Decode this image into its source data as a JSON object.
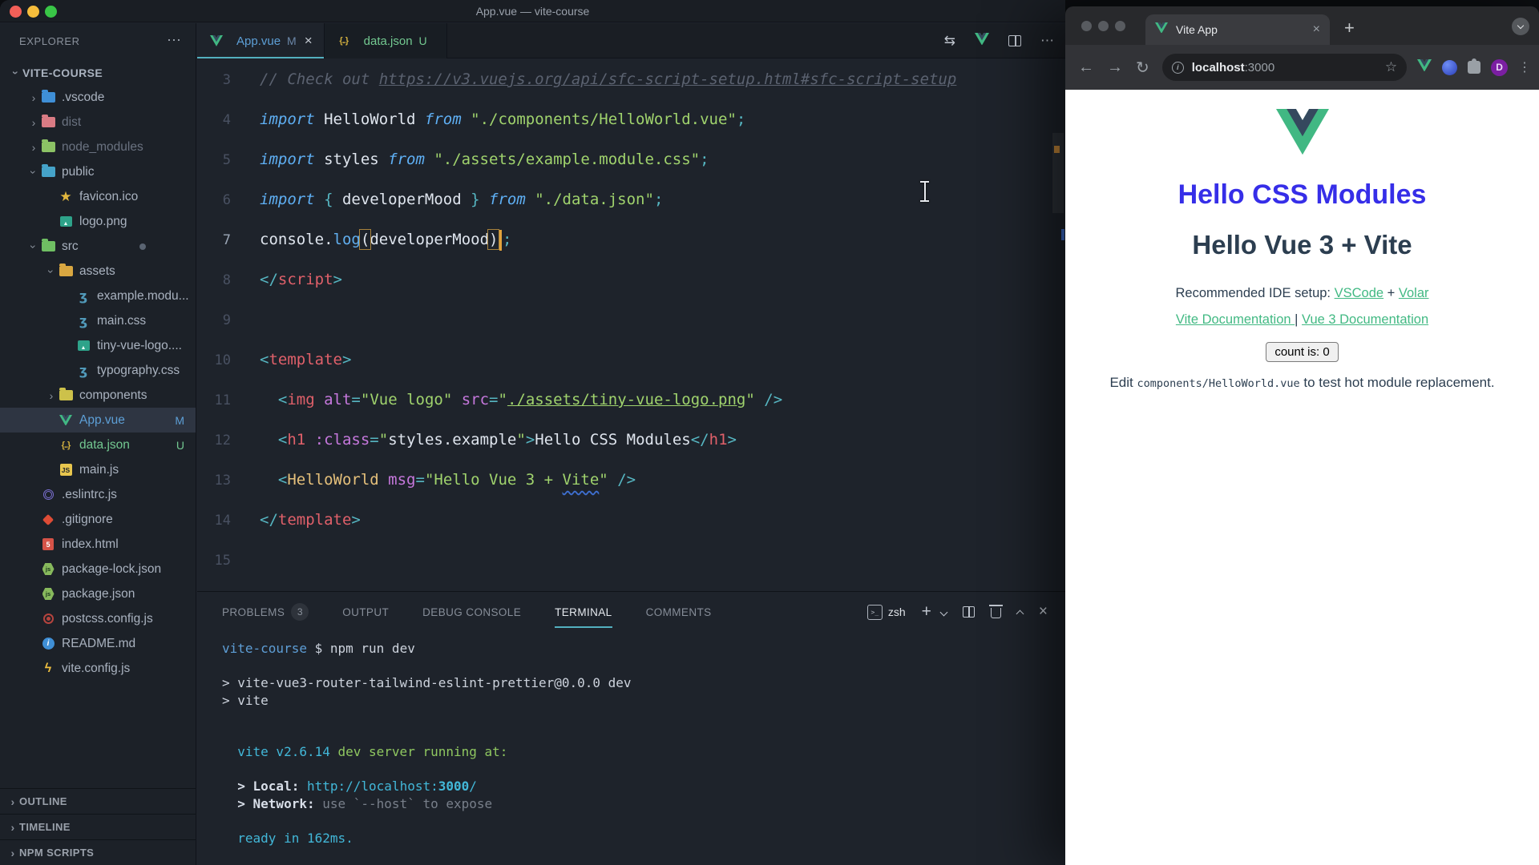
{
  "vscode": {
    "titlebar": {
      "title": "App.vue — vite-course"
    },
    "explorer": {
      "header": "EXPLORER",
      "actions_icon": "⋯",
      "root": "VITE-COURSE",
      "tree": [
        {
          "label": ".vscode",
          "icon": "folder-vscode",
          "indent": 1,
          "chevron": "right"
        },
        {
          "label": "dist",
          "icon": "folder-dist",
          "indent": 1,
          "chevron": "right",
          "muted": true
        },
        {
          "label": "node_modules",
          "icon": "folder-node",
          "indent": 1,
          "chevron": "right",
          "muted": true
        },
        {
          "label": "public",
          "icon": "folder-public",
          "indent": 1,
          "chevron": "down"
        },
        {
          "label": "favicon.ico",
          "icon": "star",
          "indent": 2
        },
        {
          "label": "logo.png",
          "icon": "image",
          "indent": 2
        },
        {
          "label": "src",
          "icon": "folder-src",
          "indent": 1,
          "chevron": "down",
          "dot": true
        },
        {
          "label": "assets",
          "icon": "folder-assets",
          "indent": 2,
          "chevron": "down"
        },
        {
          "label": "example.modu...",
          "icon": "css",
          "indent": 3
        },
        {
          "label": "main.css",
          "icon": "css",
          "indent": 3
        },
        {
          "label": "tiny-vue-logo....",
          "icon": "image",
          "indent": 3
        },
        {
          "label": "typography.css",
          "icon": "css",
          "indent": 3
        },
        {
          "label": "components",
          "icon": "folder-components",
          "indent": 2,
          "chevron": "right"
        },
        {
          "label": "App.vue",
          "icon": "vue",
          "indent": 2,
          "selected": true,
          "badge": "M",
          "color": "blue"
        },
        {
          "label": "data.json",
          "icon": "json",
          "indent": 2,
          "badge": "U",
          "color": "green"
        },
        {
          "label": "main.js",
          "icon": "js",
          "indent": 2
        },
        {
          "label": ".eslintrc.js",
          "icon": "eslint",
          "indent": 1
        },
        {
          "label": ".gitignore",
          "icon": "git",
          "indent": 1
        },
        {
          "label": "index.html",
          "icon": "html",
          "indent": 1
        },
        {
          "label": "package-lock.json",
          "icon": "npm",
          "indent": 1
        },
        {
          "label": "package.json",
          "icon": "npm",
          "indent": 1
        },
        {
          "label": "postcss.config.js",
          "icon": "postcss",
          "indent": 1
        },
        {
          "label": "README.md",
          "icon": "readme",
          "indent": 1
        },
        {
          "label": "vite.config.js",
          "icon": "vite",
          "indent": 1
        }
      ],
      "sections": [
        "OUTLINE",
        "TIMELINE",
        "NPM SCRIPTS"
      ]
    },
    "tabs": [
      {
        "label": "App.vue",
        "icon": "vue",
        "badge": "M",
        "close": "×",
        "active": true,
        "color": "blue"
      },
      {
        "label": "data.json",
        "icon": "json",
        "badge": "U",
        "active": false,
        "color": "green"
      }
    ],
    "editor_lines": [
      {
        "n": "3",
        "tokens": [
          [
            "com",
            "// Check out "
          ],
          [
            "comU",
            "https://v3.vuejs.org/api/sfc-script-setup.html#sfc-script-setup"
          ]
        ]
      },
      {
        "n": "4",
        "tokens": [
          [
            "kw",
            "import"
          ],
          [
            "id",
            " HelloWorld "
          ],
          [
            "kw",
            "from"
          ],
          [
            "str",
            " \"./components/HelloWorld.vue\""
          ],
          [
            "pun",
            ";"
          ]
        ]
      },
      {
        "n": "5",
        "tokens": [
          [
            "kw",
            "import"
          ],
          [
            "id",
            " styles "
          ],
          [
            "kw",
            "from"
          ],
          [
            "str",
            " \"./assets/example.module.css\""
          ],
          [
            "pun",
            ";"
          ]
        ]
      },
      {
        "n": "6",
        "tokens": [
          [
            "kw",
            "import"
          ],
          [
            "pun",
            " { "
          ],
          [
            "id",
            "developerMood"
          ],
          [
            "pun",
            " } "
          ],
          [
            "kw",
            "from"
          ],
          [
            "str",
            " \"./data.json\""
          ],
          [
            "pun",
            ";"
          ]
        ]
      },
      {
        "n": "7",
        "active": true,
        "tokens": [
          [
            "id",
            "console"
          ],
          [
            "id",
            "."
          ],
          [
            "fn",
            "log"
          ],
          [
            "box",
            "("
          ],
          [
            "id",
            "developerMood"
          ],
          [
            "box",
            ")"
          ],
          [
            "cursor",
            ""
          ],
          [
            "pun",
            ";"
          ]
        ]
      },
      {
        "n": "8",
        "tokens": [
          [
            "pun",
            "</"
          ],
          [
            "tag",
            "script"
          ],
          [
            "pun",
            ">"
          ]
        ]
      },
      {
        "n": "9",
        "tokens": []
      },
      {
        "n": "10",
        "tokens": [
          [
            "pun",
            "<"
          ],
          [
            "tag",
            "template"
          ],
          [
            "pun",
            ">"
          ]
        ]
      },
      {
        "n": "11",
        "tokens": [
          [
            "pun",
            "  <"
          ],
          [
            "tag",
            "img"
          ],
          [
            "attr",
            " alt"
          ],
          [
            "pun",
            "="
          ],
          [
            "str",
            "\"Vue logo\""
          ],
          [
            "attr",
            " src"
          ],
          [
            "pun",
            "="
          ],
          [
            "str",
            "\""
          ],
          [
            "strU",
            "./assets/tiny-vue-logo.png"
          ],
          [
            "str",
            "\""
          ],
          [
            "pun",
            " />"
          ]
        ]
      },
      {
        "n": "12",
        "tokens": [
          [
            "pun",
            "  <"
          ],
          [
            "tag",
            "h1"
          ],
          [
            "attr",
            " :class"
          ],
          [
            "pun",
            "="
          ],
          [
            "str",
            "\""
          ],
          [
            "id",
            "styles.example"
          ],
          [
            "str",
            "\""
          ],
          [
            "pun",
            ">"
          ],
          [
            "id",
            "Hello CSS Modules"
          ],
          [
            "pun",
            "</"
          ],
          [
            "tag",
            "h1"
          ],
          [
            "pun",
            ">"
          ]
        ]
      },
      {
        "n": "13",
        "tokens": [
          [
            "pun",
            "  <"
          ],
          [
            "comp",
            "HelloWorld"
          ],
          [
            "attr",
            " msg"
          ],
          [
            "pun",
            "="
          ],
          [
            "str",
            "\"Hello Vue 3 + "
          ],
          [
            "wavy",
            "Vite"
          ],
          [
            "str",
            "\""
          ],
          [
            "pun",
            " />"
          ]
        ]
      },
      {
        "n": "14",
        "tokens": [
          [
            "pun",
            "</"
          ],
          [
            "tag",
            "template"
          ],
          [
            "pun",
            ">"
          ]
        ]
      },
      {
        "n": "15",
        "tokens": []
      }
    ],
    "panel": {
      "tabs": [
        {
          "label": "PROBLEMS",
          "badge": "3"
        },
        {
          "label": "OUTPUT"
        },
        {
          "label": "DEBUG CONSOLE"
        },
        {
          "label": "TERMINAL",
          "active": true
        },
        {
          "label": "COMMENTS"
        }
      ],
      "shell": "zsh",
      "terminal": [
        {
          "segs": [
            [
              "tb",
              "vite-course"
            ],
            [
              "tw",
              " $ npm run dev"
            ]
          ]
        },
        {
          "segs": []
        },
        {
          "segs": [
            [
              "tw",
              "> vite-vue3-router-tailwind-eslint-prettier@0.0.0 dev"
            ]
          ]
        },
        {
          "segs": [
            [
              "tw",
              "> vite"
            ]
          ]
        },
        {
          "segs": []
        },
        {
          "segs": []
        },
        {
          "segs": [
            [
              "tc",
              "  vite v2.6.14"
            ],
            [
              "tg",
              " dev server running at:"
            ]
          ]
        },
        {
          "segs": []
        },
        {
          "segs": [
            [
              "twb",
              "  > Local: "
            ],
            [
              "tc",
              "http://localhost:"
            ],
            [
              "tcb",
              "3000"
            ],
            [
              "tc",
              "/"
            ]
          ]
        },
        {
          "segs": [
            [
              "twb",
              "  > Network: "
            ],
            [
              "tdim",
              "use `--host` to expose"
            ]
          ]
        },
        {
          "segs": []
        },
        {
          "segs": [
            [
              "tc",
              "  ready in 162ms."
            ]
          ]
        }
      ]
    }
  },
  "browser": {
    "tab": {
      "title": "Vite App",
      "close": "×"
    },
    "newtab_icon": "+",
    "address": {
      "host": "localhost",
      "port": ":3000",
      "star": "☆",
      "back": "←",
      "forward": "→",
      "reload": "↻",
      "info": "i"
    },
    "avatar_letter": "D",
    "menu_icon": "⋮",
    "page": {
      "heading_css_modules": "Hello CSS Modules",
      "heading_msg": "Hello Vue 3 + Vite",
      "ide_prefix": "Recommended IDE setup: ",
      "ide_link1": "VSCode",
      "ide_sep": " + ",
      "ide_link2": "Volar",
      "docs_link1": "Vite Documentation ",
      "docs_sep": "| ",
      "docs_link2": "Vue 3 Documentation",
      "count_button": "count is: 0",
      "edit_prefix": "Edit ",
      "edit_code": "components/HelloWorld.vue",
      "edit_suffix": " to test hot module replacement."
    },
    "colors": {
      "accent_blue": "#362ee8",
      "heading_dark": "#2c3e50",
      "link_green": "#42b983",
      "vue_green": "#41b883",
      "vue_navy": "#35495e"
    }
  }
}
